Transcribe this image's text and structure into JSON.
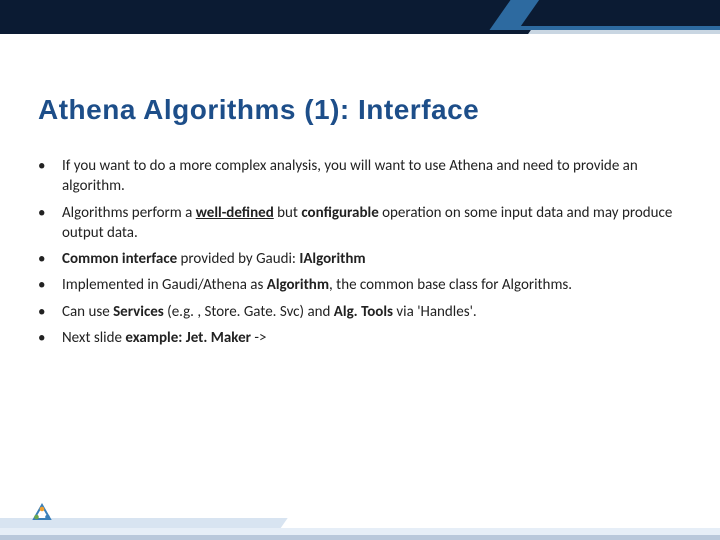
{
  "slide": {
    "title": "Athena Algorithms (1): Interface",
    "bullets": [
      [
        {
          "t": "If you want to do a more complex analysis, you will want to use Athena and need to provide an algorithm."
        }
      ],
      [
        {
          "t": "Algorithms perform a "
        },
        {
          "t": "well-defined",
          "b": true,
          "u": true
        },
        {
          "t": " but "
        },
        {
          "t": "configurable",
          "b": true
        },
        {
          "t": " operation on some input data and may produce output data."
        }
      ],
      [
        {
          "t": "Common interface",
          "b": true
        },
        {
          "t": " provided by Gaudi: "
        },
        {
          "t": "IAlgorithm",
          "b": true
        }
      ],
      [
        {
          "t": "Implemented in Gaudi/Athena as "
        },
        {
          "t": "Algorithm",
          "b": true
        },
        {
          "t": ", the common base class for Algorithms."
        }
      ],
      [
        {
          "t": "Can use "
        },
        {
          "t": "Services",
          "b": true
        },
        {
          "t": " (e.g. , Store. Gate. Svc) and "
        },
        {
          "t": "Alg. Tools",
          "b": true
        },
        {
          "t": " via 'Handles'."
        }
      ],
      [
        {
          "t": "Next slide "
        },
        {
          "t": "example: Jet. Maker",
          "b": true
        },
        {
          "t": " ->"
        }
      ]
    ]
  }
}
